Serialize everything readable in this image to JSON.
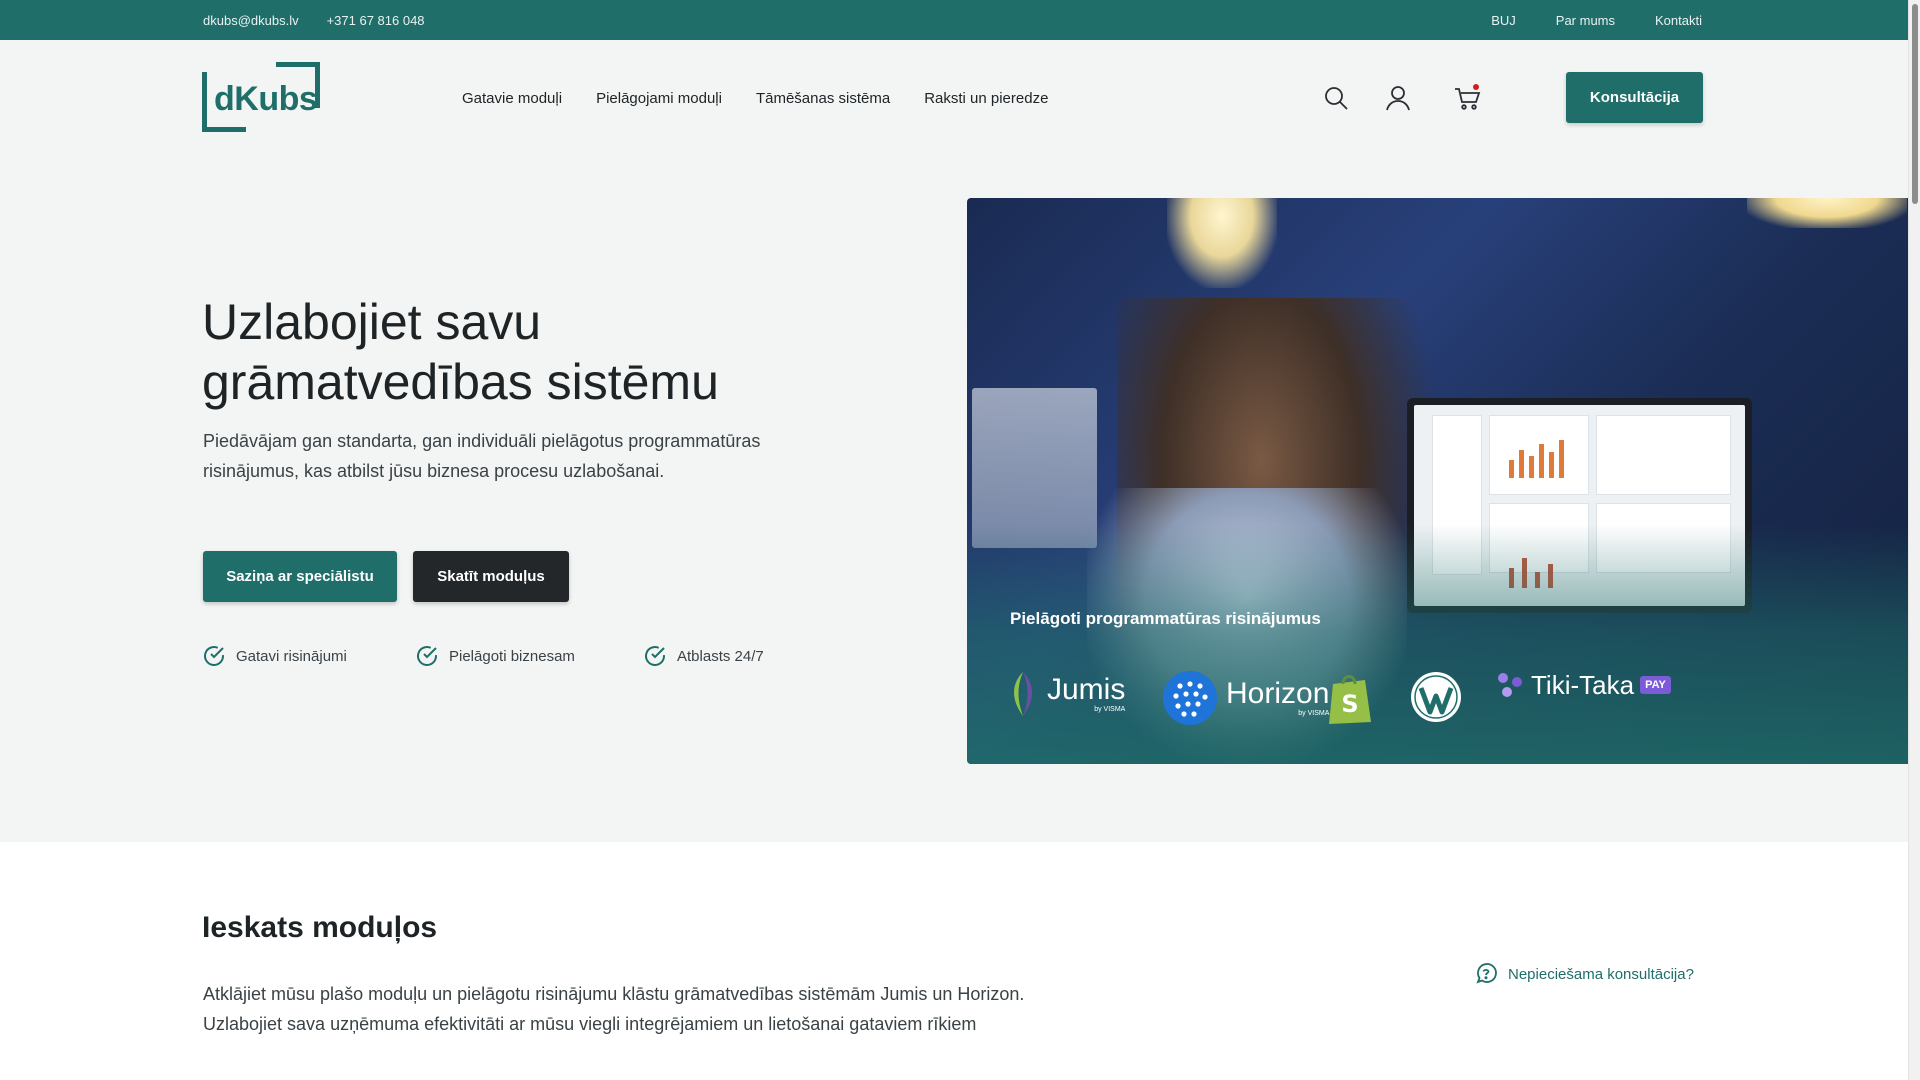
{
  "topbar": {
    "email": "dkubs@dkubs.lv",
    "phone": "+371 67 816 048",
    "links": [
      "BUJ",
      "Par mums",
      "Kontakti"
    ]
  },
  "header": {
    "logo_text": "dKubs",
    "nav": [
      "Gatavie moduļi",
      "Pielāgojami moduļi",
      "Tāmēšanas sistēma",
      "Raksti un pieredze"
    ],
    "icons": [
      "search-icon",
      "user-icon",
      "cart-icon"
    ],
    "cta": "Konsultācija"
  },
  "hero": {
    "title": "Uzlabojiet savu grāmatvedības sistēmu",
    "subtitle": "Piedāvājam gan standarta, gan individuāli pielāgotus programmatūras risinājumus, kas atbilst jūsu biznesa procesu uzlabošanai.",
    "primary_button": "Saziņa ar speciālistu",
    "secondary_button": "Skatīt moduļus",
    "features": [
      "Gatavi risinājumi",
      "Pielāgoti biznesam",
      "Atblasts 24/7"
    ],
    "image_caption": "Pielāgoti programmatūras risinājumus",
    "brands": {
      "jumis": "Jumis",
      "jumis_by": "by VISMA",
      "horizon": "Horizon",
      "horizon_by": "by VISMA",
      "tikitaka": "Tiki-Taka",
      "pay": "PAY"
    }
  },
  "modules": {
    "title": "Ieskats moduļos",
    "text": "Atklājiet mūsu plašo moduļu un pielāgotu risinājumu klāstu grāmatvedības sistēmām Jumis un Horizon. Uzlabojiet sava uzņēmuma efektivitāti ar mūsu viegli integrējamiem un lietošanai gataviem rīkiem",
    "help_link": "Nepieciešama konsultācija?"
  },
  "colors": {
    "brand": "#1f6e69",
    "dark_button": "#24272a",
    "hero_bg": "#f2f5f4",
    "cart_badge": "#d01c1c"
  }
}
